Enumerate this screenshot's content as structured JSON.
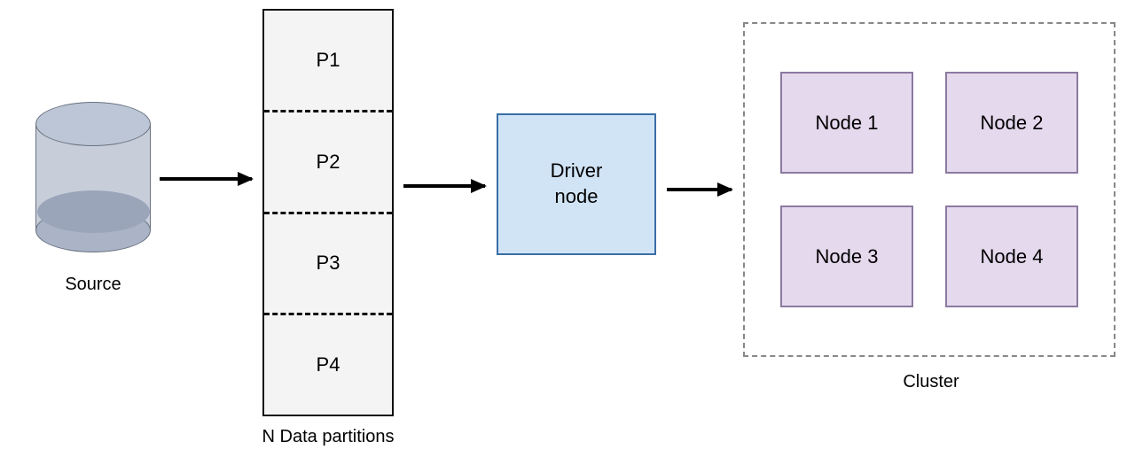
{
  "source": {
    "label": "Source"
  },
  "partitions": {
    "items": [
      "P1",
      "P2",
      "P3",
      "P4"
    ],
    "caption": "N Data partitions"
  },
  "driver": {
    "label": "Driver\nnode"
  },
  "cluster": {
    "nodes": [
      "Node 1",
      "Node 2",
      "Node 3",
      "Node 4"
    ],
    "caption": "Cluster"
  },
  "colors": {
    "driver_bg": "#d1e4f6",
    "driver_border": "#3a6ea5",
    "node_bg": "#e5d9ee",
    "node_border": "#8c7aa0",
    "db_body": "#c7ceda"
  }
}
